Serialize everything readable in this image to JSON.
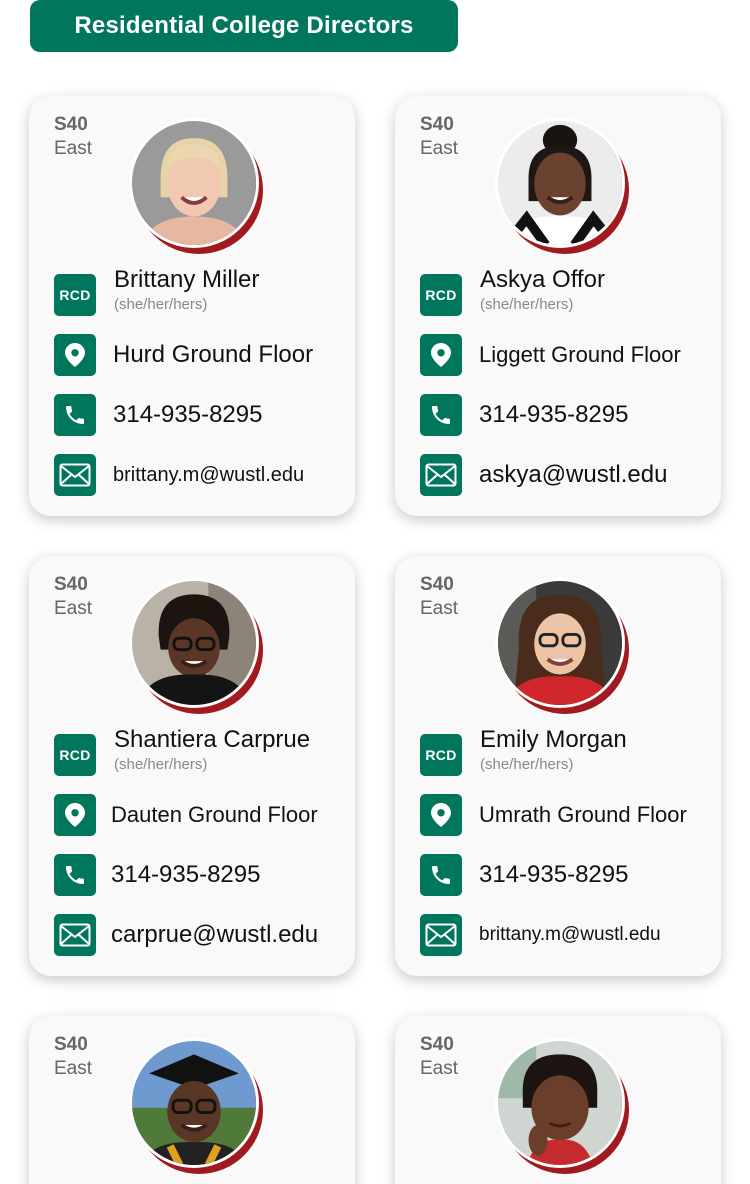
{
  "header": {
    "title": "Residential College Directors"
  },
  "colors": {
    "brand_green": "#00775c",
    "accent_red": "#a11a1f",
    "card_bg": "#f9f9f9"
  },
  "icons": {
    "badge": "RCD",
    "location": "map-pin-icon",
    "phone": "phone-icon",
    "email": "envelope-icon"
  },
  "cards": [
    {
      "code": "S40",
      "area": "East",
      "badge": "RCD",
      "name": "Brittany Miller",
      "pronouns": "(she/her/hers)",
      "location": "Hurd Ground Floor",
      "phone": "314-935-8295",
      "email": "brittany.m@wustl.edu"
    },
    {
      "code": "S40",
      "area": "East",
      "badge": "RCD",
      "name": "Askya Offor",
      "pronouns": "(she/her/hers)",
      "location": "Liggett Ground Floor",
      "phone": "314-935-8295",
      "email": "askya@wustl.edu"
    },
    {
      "code": "S40",
      "area": "East",
      "badge": "RCD",
      "name": "Shantiera Carprue",
      "pronouns": "(she/her/hers)",
      "location": "Dauten Ground Floor",
      "phone": "314-935-8295",
      "email": "carprue@wustl.edu"
    },
    {
      "code": "S40",
      "area": "East",
      "badge": "RCD",
      "name": "Emily Morgan",
      "pronouns": "(she/her/hers)",
      "location": "Umrath Ground Floor",
      "phone": "314-935-8295",
      "email": "brittany.m@wustl.edu"
    },
    {
      "code": "S40",
      "area": "East"
    },
    {
      "code": "S40",
      "area": "East"
    }
  ]
}
